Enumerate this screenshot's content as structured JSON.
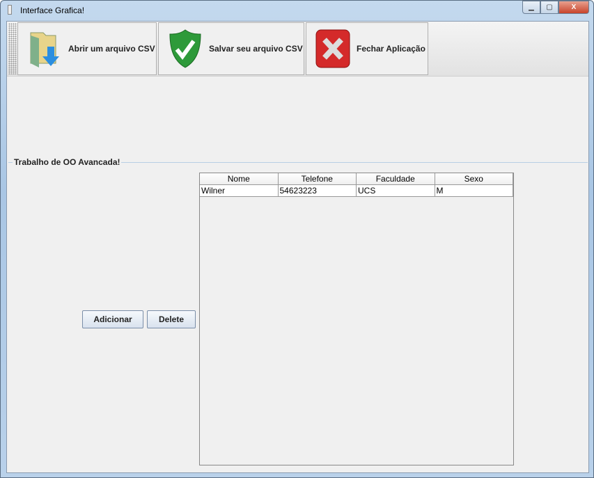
{
  "window": {
    "title": "Interface Grafica!",
    "minimize": "▁",
    "maximize": "▢",
    "close": "X"
  },
  "toolbar": {
    "open_label": "Abrir um arquivo CSV",
    "save_label": "Salvar seu arquivo CSV",
    "close_label": "Fechar Aplicação"
  },
  "panel": {
    "title": "Trabalho de OO Avancada!",
    "add_label": "Adicionar",
    "delete_label": "Delete"
  },
  "table": {
    "columns": [
      "Nome",
      "Telefone",
      "Faculdade",
      "Sexo"
    ],
    "rows": [
      [
        "Wilner",
        "54623223",
        "UCS",
        "M"
      ]
    ]
  }
}
